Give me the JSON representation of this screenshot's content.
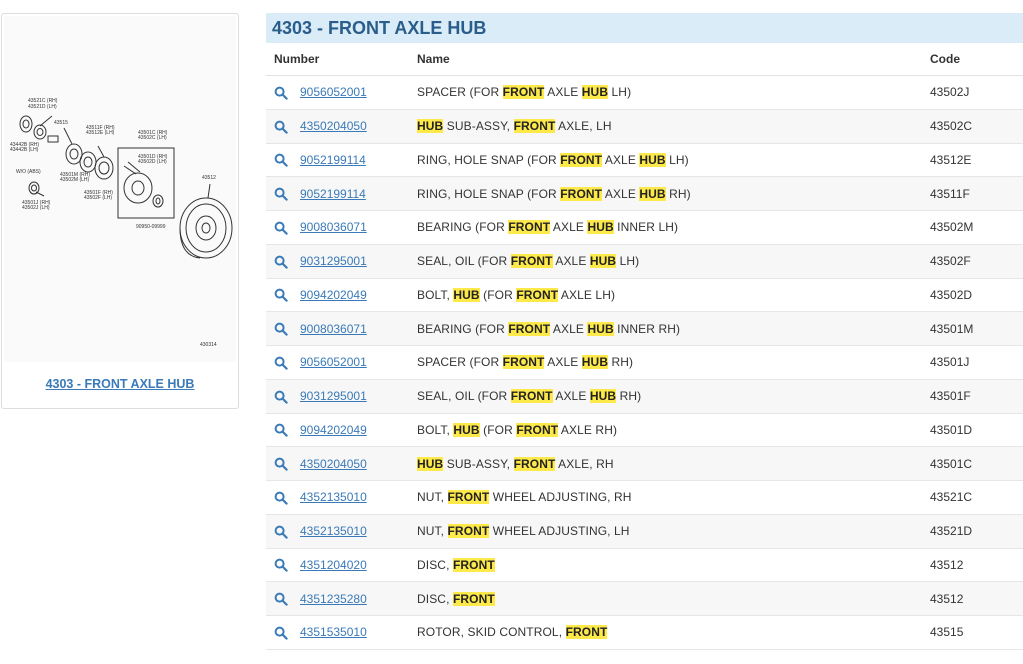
{
  "sidebar": {
    "diagram_caption": "4303 - FRONT AXLE HUB",
    "diagram_labels": {
      "l1": "43521C (RH)",
      "l2": "43521D (LH)",
      "l3": "43515",
      "l4": "43511F (RH)",
      "l5": "43512E (LH)",
      "l6": "43501C (RH)",
      "l7": "43502C (LH)",
      "l8": "43442B (RH)",
      "l9": "43442B (LH)",
      "l10": "43501M (RH)",
      "l11": "43502M (LH)",
      "l12": "43501D (RH)",
      "l13": "43502D (LH)",
      "l14": "W/O (ABS)",
      "l15": "43501F (RH)",
      "l16": "43502F (LH)",
      "l17": "43512",
      "l18": "43501J (RH)",
      "l19": "43502J (LH)",
      "l20": "90950-09999",
      "l21": "430314"
    }
  },
  "panel": {
    "title": "4303 - FRONT AXLE HUB",
    "headers": {
      "number": "Number",
      "name": "Name",
      "code": "Code"
    },
    "rows": [
      {
        "number": "9056052001",
        "name": [
          [
            "SPACER (FOR ",
            false
          ],
          [
            "FRONT",
            true
          ],
          [
            " AXLE ",
            false
          ],
          [
            "HUB",
            true
          ],
          [
            " LH)",
            false
          ]
        ],
        "code": "43502J"
      },
      {
        "number": "4350204050",
        "name": [
          [
            "HUB",
            true
          ],
          [
            " SUB-ASSY, ",
            false
          ],
          [
            "FRONT",
            true
          ],
          [
            " AXLE, LH",
            false
          ]
        ],
        "code": "43502C"
      },
      {
        "number": "9052199114",
        "name": [
          [
            "RING, HOLE SNAP (FOR ",
            false
          ],
          [
            "FRONT",
            true
          ],
          [
            " AXLE ",
            false
          ],
          [
            "HUB",
            true
          ],
          [
            " LH)",
            false
          ]
        ],
        "code": "43512E"
      },
      {
        "number": "9052199114",
        "name": [
          [
            "RING, HOLE SNAP (FOR ",
            false
          ],
          [
            "FRONT",
            true
          ],
          [
            " AXLE ",
            false
          ],
          [
            "HUB",
            true
          ],
          [
            " RH)",
            false
          ]
        ],
        "code": "43511F"
      },
      {
        "number": "9008036071",
        "name": [
          [
            "BEARING (FOR ",
            false
          ],
          [
            "FRONT",
            true
          ],
          [
            " AXLE ",
            false
          ],
          [
            "HUB",
            true
          ],
          [
            " INNER LH)",
            false
          ]
        ],
        "code": "43502M"
      },
      {
        "number": "9031295001",
        "name": [
          [
            "SEAL, OIL (FOR ",
            false
          ],
          [
            "FRONT",
            true
          ],
          [
            " AXLE ",
            false
          ],
          [
            "HUB",
            true
          ],
          [
            " LH)",
            false
          ]
        ],
        "code": "43502F"
      },
      {
        "number": "9094202049",
        "name": [
          [
            "BOLT, ",
            false
          ],
          [
            "HUB",
            true
          ],
          [
            " (FOR ",
            false
          ],
          [
            "FRONT",
            true
          ],
          [
            " AXLE LH)",
            false
          ]
        ],
        "code": "43502D"
      },
      {
        "number": "9008036071",
        "name": [
          [
            "BEARING (FOR ",
            false
          ],
          [
            "FRONT",
            true
          ],
          [
            " AXLE ",
            false
          ],
          [
            "HUB",
            true
          ],
          [
            " INNER RH)",
            false
          ]
        ],
        "code": "43501M"
      },
      {
        "number": "9056052001",
        "name": [
          [
            "SPACER (FOR ",
            false
          ],
          [
            "FRONT",
            true
          ],
          [
            " AXLE ",
            false
          ],
          [
            "HUB",
            true
          ],
          [
            " RH)",
            false
          ]
        ],
        "code": "43501J"
      },
      {
        "number": "9031295001",
        "name": [
          [
            "SEAL, OIL (FOR ",
            false
          ],
          [
            "FRONT",
            true
          ],
          [
            " AXLE ",
            false
          ],
          [
            "HUB",
            true
          ],
          [
            " RH)",
            false
          ]
        ],
        "code": "43501F"
      },
      {
        "number": "9094202049",
        "name": [
          [
            "BOLT, ",
            false
          ],
          [
            "HUB",
            true
          ],
          [
            " (FOR ",
            false
          ],
          [
            "FRONT",
            true
          ],
          [
            " AXLE RH)",
            false
          ]
        ],
        "code": "43501D"
      },
      {
        "number": "4350204050",
        "name": [
          [
            "HUB",
            true
          ],
          [
            " SUB-ASSY, ",
            false
          ],
          [
            "FRONT",
            true
          ],
          [
            " AXLE, RH",
            false
          ]
        ],
        "code": "43501C"
      },
      {
        "number": "4352135010",
        "name": [
          [
            "NUT, ",
            false
          ],
          [
            "FRONT",
            true
          ],
          [
            " WHEEL ADJUSTING, RH",
            false
          ]
        ],
        "code": "43521C"
      },
      {
        "number": "4352135010",
        "name": [
          [
            "NUT, ",
            false
          ],
          [
            "FRONT",
            true
          ],
          [
            " WHEEL ADJUSTING, LH",
            false
          ]
        ],
        "code": "43521D"
      },
      {
        "number": "4351204020",
        "name": [
          [
            "DISC, ",
            false
          ],
          [
            "FRONT",
            true
          ]
        ],
        "code": "43512"
      },
      {
        "number": "4351235280",
        "name": [
          [
            "DISC, ",
            false
          ],
          [
            "FRONT",
            true
          ]
        ],
        "code": "43512"
      },
      {
        "number": "4351535010",
        "name": [
          [
            "ROTOR, SKID CONTROL, ",
            false
          ],
          [
            "FRONT",
            true
          ]
        ],
        "code": "43515"
      }
    ]
  },
  "colors": {
    "title_bg": "#d9ecf8",
    "title_text": "#2a5d8a",
    "link": "#3a7ab8",
    "highlight": "#fde94a",
    "row_alt": "#f7f7f7"
  },
  "icons": {
    "row_action": "search-icon"
  }
}
